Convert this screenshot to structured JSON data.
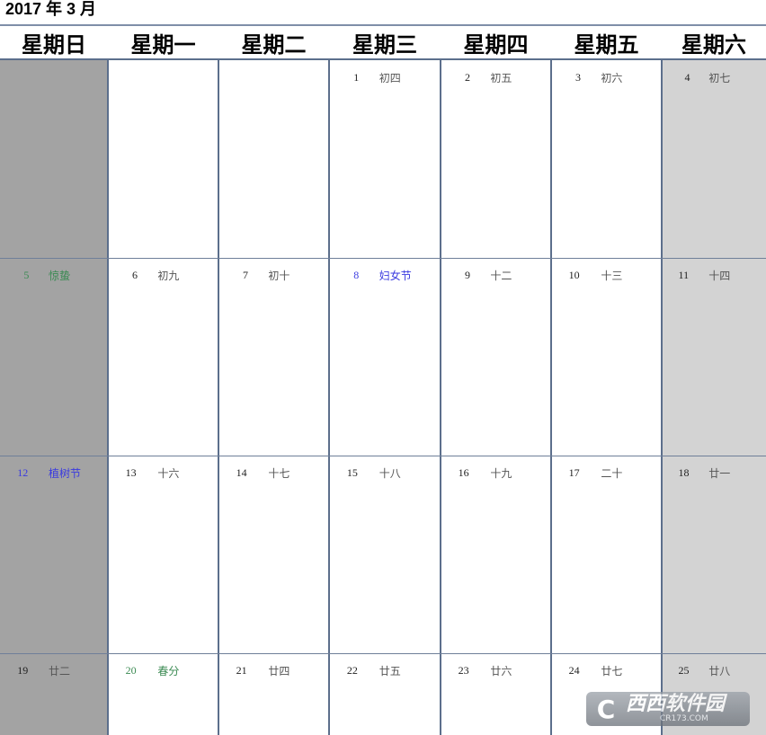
{
  "title": "2017 年 3 月",
  "weekdays": [
    "星期日",
    "星期一",
    "星期二",
    "星期三",
    "星期四",
    "星期五",
    "星期六"
  ],
  "colors": {
    "sunday_bg": "#a3a3a3",
    "saturday_bg": "#d3d3d3",
    "solar_term": "#3a8a52",
    "festival": "#3a3ae0",
    "grid_line": "#5c6f8c"
  },
  "weeks": [
    [
      null,
      null,
      null,
      {
        "day": "1",
        "lunar": "初四"
      },
      {
        "day": "2",
        "lunar": "初五"
      },
      {
        "day": "3",
        "lunar": "初六"
      },
      {
        "day": "4",
        "lunar": "初七"
      }
    ],
    [
      {
        "day": "5",
        "lunar": "惊蛰",
        "type": "solar_term"
      },
      {
        "day": "6",
        "lunar": "初九"
      },
      {
        "day": "7",
        "lunar": "初十"
      },
      {
        "day": "8",
        "lunar": "妇女节",
        "type": "festival"
      },
      {
        "day": "9",
        "lunar": "十二"
      },
      {
        "day": "10",
        "lunar": "十三"
      },
      {
        "day": "11",
        "lunar": "十四"
      }
    ],
    [
      {
        "day": "12",
        "lunar": "植树节",
        "type": "festival"
      },
      {
        "day": "13",
        "lunar": "十六"
      },
      {
        "day": "14",
        "lunar": "十七"
      },
      {
        "day": "15",
        "lunar": "十八"
      },
      {
        "day": "16",
        "lunar": "十九"
      },
      {
        "day": "17",
        "lunar": "二十"
      },
      {
        "day": "18",
        "lunar": "廿一"
      }
    ],
    [
      {
        "day": "19",
        "lunar": "廿二"
      },
      {
        "day": "20",
        "lunar": "春分",
        "type": "solar_term"
      },
      {
        "day": "21",
        "lunar": "廿四"
      },
      {
        "day": "22",
        "lunar": "廿五"
      },
      {
        "day": "23",
        "lunar": "廿六"
      },
      {
        "day": "24",
        "lunar": "廿七"
      },
      {
        "day": "25",
        "lunar": "廿八"
      }
    ]
  ],
  "watermark": {
    "logo_glyph": "C",
    "main": "西西软件园",
    "sub": "CR173.COM"
  }
}
